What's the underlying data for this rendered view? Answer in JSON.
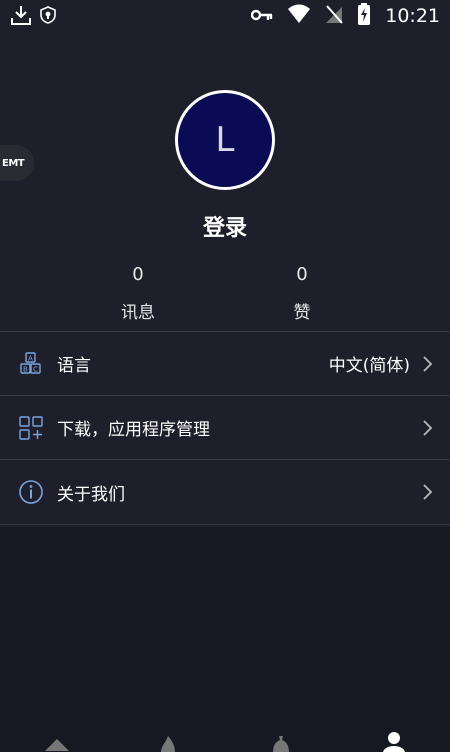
{
  "status_bar": {
    "time": "10:21",
    "icons": [
      "download-icon",
      "shield-icon",
      "key-icon",
      "wifi-icon",
      "no-signal-icon",
      "battery-charging-icon"
    ]
  },
  "side_logo": {
    "text": "EMT"
  },
  "profile": {
    "avatar_letter": "L",
    "login_label": "登录",
    "stats": [
      {
        "value": "0",
        "label": "讯息"
      },
      {
        "value": "0",
        "label": "赞"
      }
    ]
  },
  "menu": {
    "items": [
      {
        "label": "语言",
        "value": "中文(简体)",
        "icon": "language-icon"
      },
      {
        "label": "下载，应用程序管理",
        "value": "",
        "icon": "apps-grid-icon"
      },
      {
        "label": "关于我们",
        "value": "",
        "icon": "info-icon"
      }
    ]
  },
  "bottom_nav": {
    "items": [
      "home-icon",
      "flame-icon",
      "money-bag-icon",
      "profile-icon"
    ]
  },
  "colors": {
    "background": "#161922",
    "panel": "#1f1f2b",
    "avatar_fill": "#0a0a55",
    "divider": "#3a3a46",
    "icon_accent": "#7aa6e0"
  }
}
